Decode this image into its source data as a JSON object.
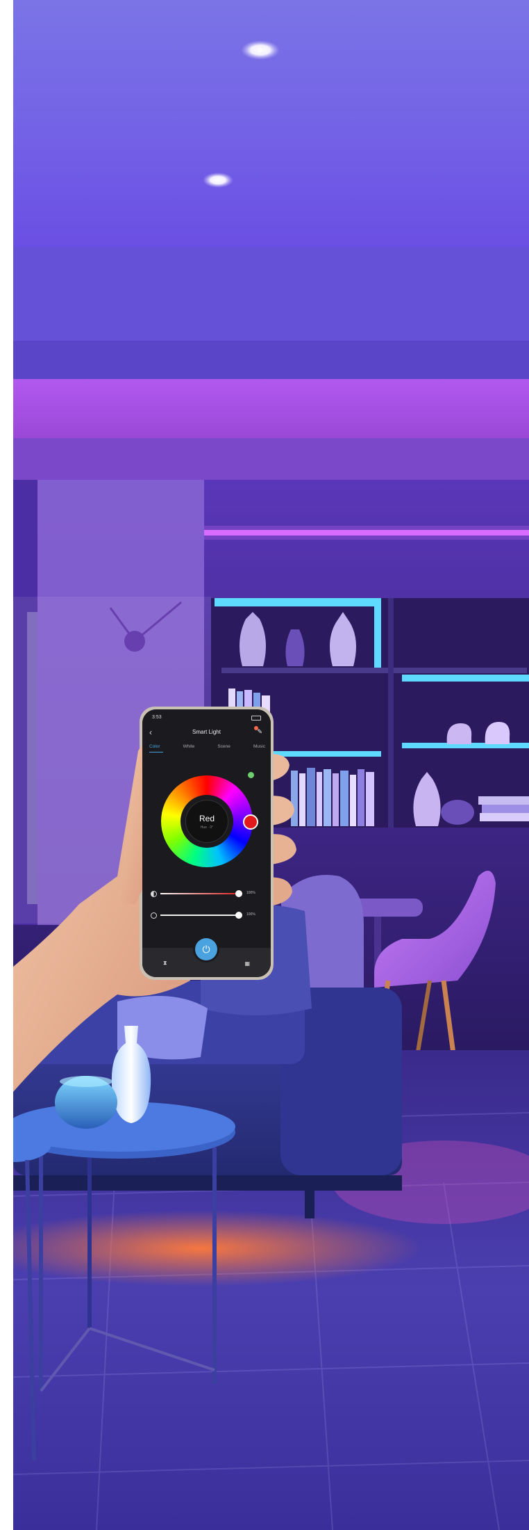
{
  "phone": {
    "status_time": "3:53",
    "title": "Smart Light",
    "tabs": [
      "Color",
      "White",
      "Scene",
      "Music"
    ],
    "active_tab": "Color",
    "color_name": "Red",
    "color_sub": "Hue · 0°",
    "brightness_label": "100%",
    "saturation_label": "100%",
    "brightness_level": 1.0,
    "saturation_level": 1.0
  },
  "colors": {
    "accent": "#4aa3df",
    "selected_color": "#e11b1b",
    "room_purple": "#6a3fd6",
    "led_magenta": "#c23bf0",
    "led_cyan": "#39d7ff"
  }
}
